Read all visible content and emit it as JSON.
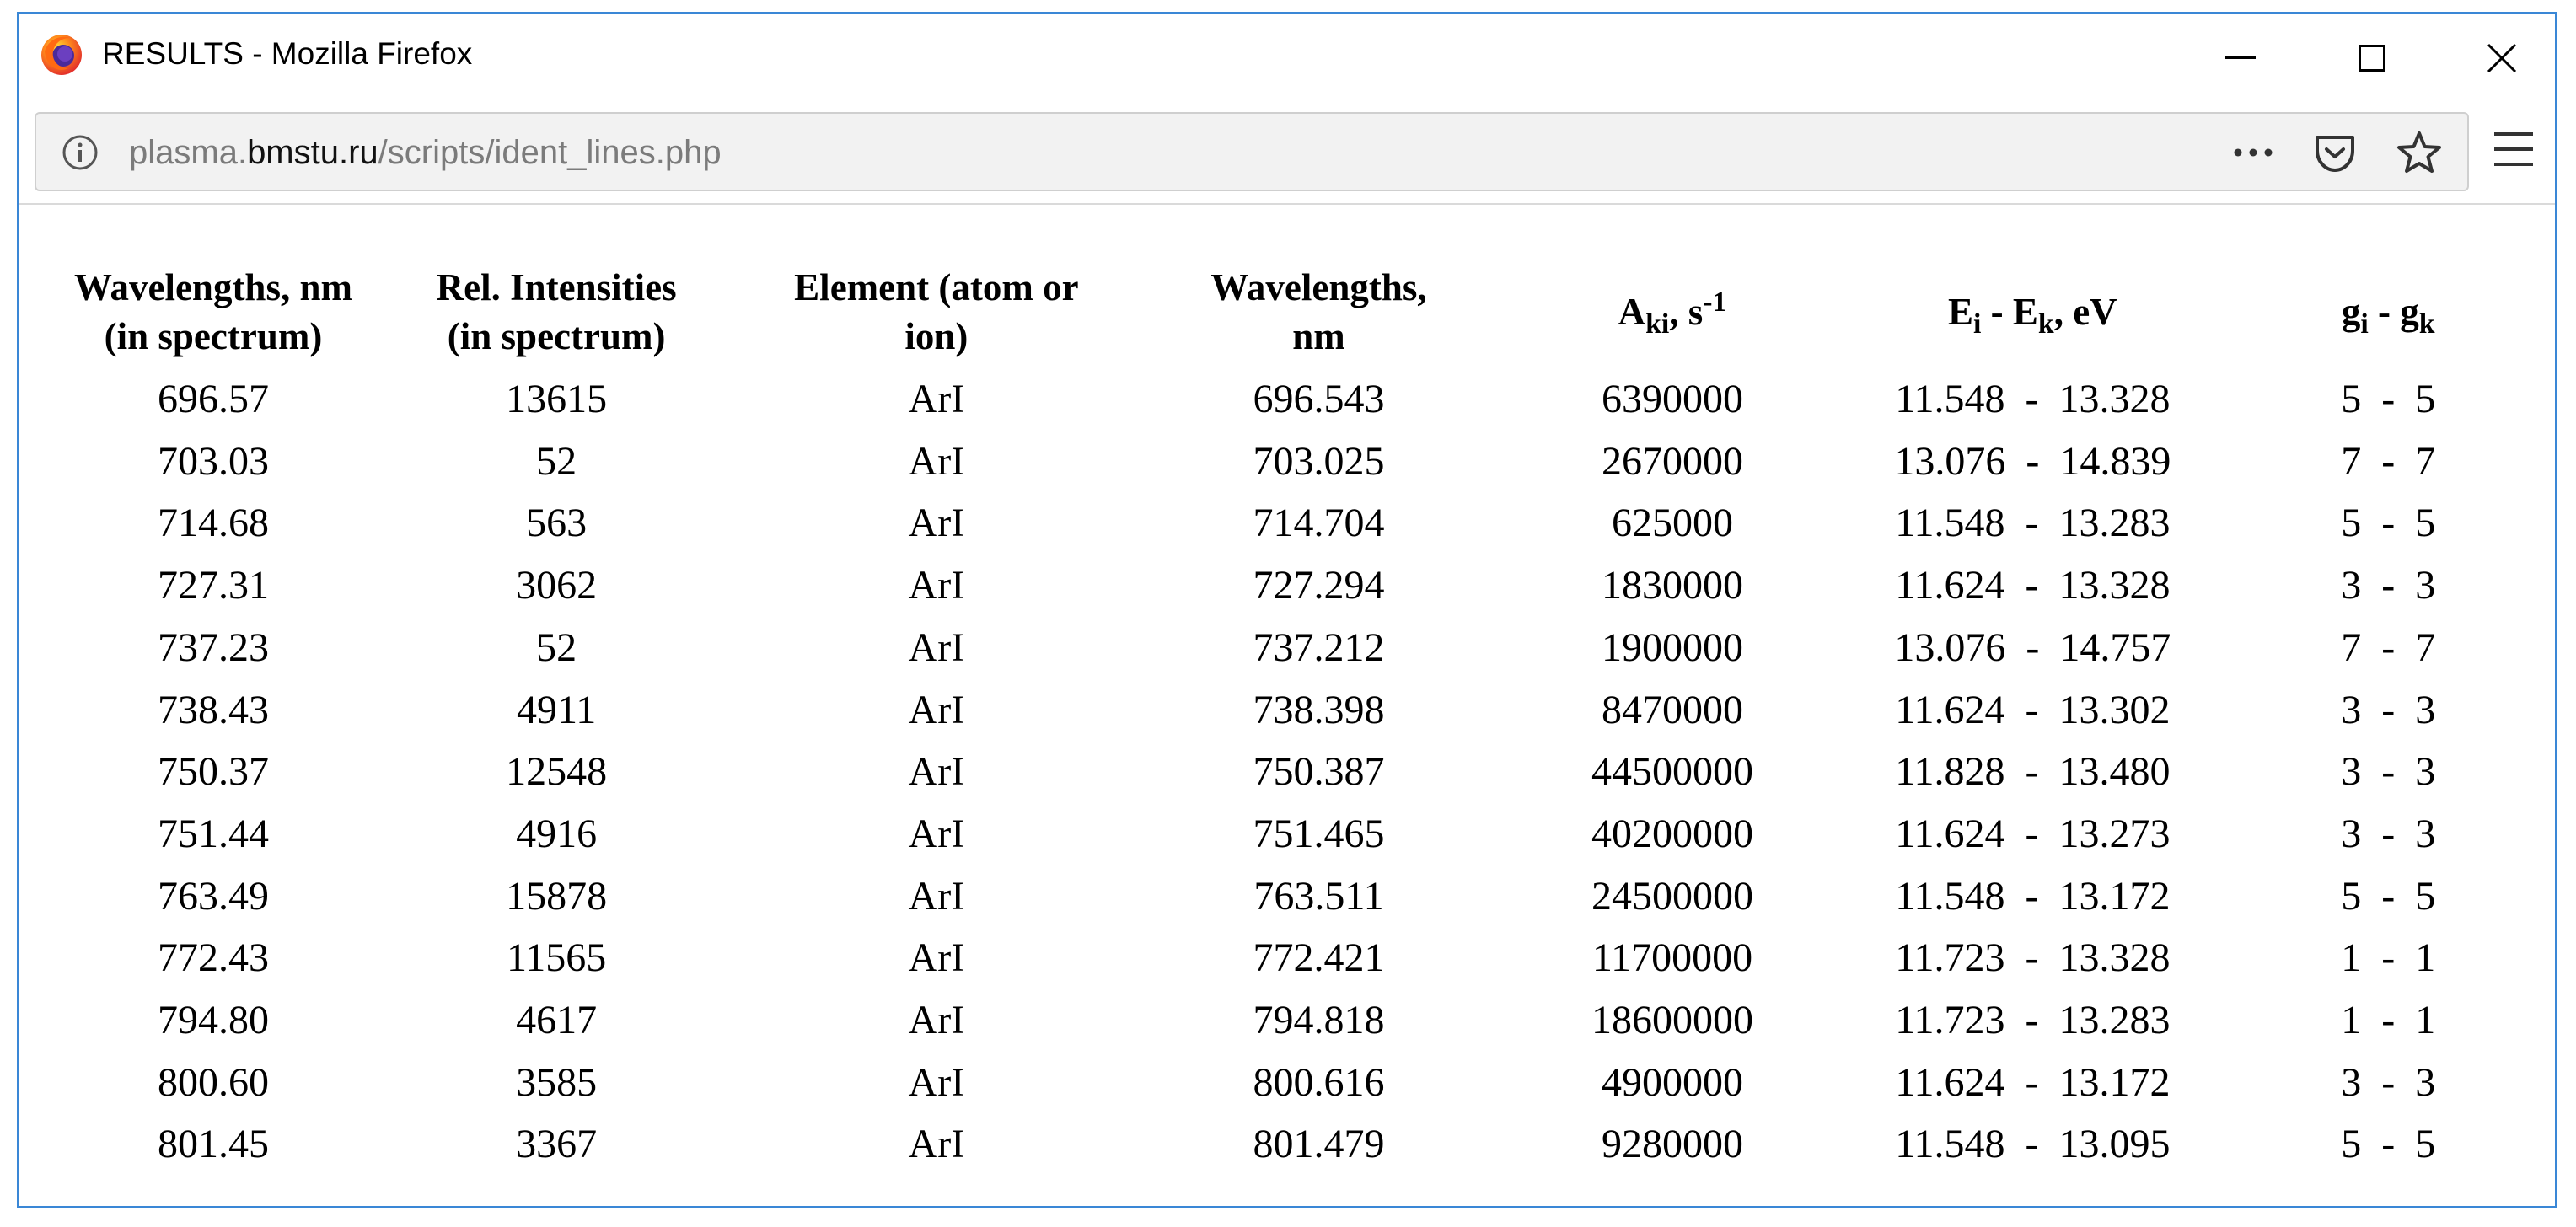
{
  "window": {
    "title": "RESULTS - Mozilla Firefox",
    "controls": {
      "minimize_icon": "minimize-icon",
      "maximize_icon": "maximize-icon",
      "close_icon": "close-icon"
    }
  },
  "urlbar": {
    "url_prefix": "plasma.",
    "url_domain": "bmstu.ru",
    "url_path": "/scripts/ident_lines.php",
    "icons": [
      "info-icon",
      "page-actions-icon",
      "pocket-icon",
      "bookmark-star-icon",
      "hamburger-menu-icon"
    ]
  },
  "colors": {
    "window_border": "#3a87d6",
    "urlbar_bg": "#f2f2f2",
    "url_gray": "#7b7b7b"
  },
  "table": {
    "headers": {
      "wl_spectrum_line1": "Wavelengths, nm",
      "wl_spectrum_line2": "(in spectrum)",
      "rel_int_line1": "Rel. Intensities",
      "rel_int_line2": "(in spectrum)",
      "element_line1": "Element (atom or",
      "element_line2": "ion)",
      "wl_line1": "Wavelengths,",
      "wl_line2": "nm",
      "aki_main": "A",
      "aki_sub": "ki",
      "aki_comma": ", s",
      "aki_sup": "-1",
      "energy_e1": "E",
      "energy_sub1": "i",
      "energy_mid": " - E",
      "energy_sub2": "k",
      "energy_unit": ", eV",
      "g_g1": "g",
      "g_sub1": "i",
      "g_mid": " - g",
      "g_sub2": "k"
    },
    "rows": [
      {
        "wl_spectrum": "696.57",
        "rel_intensity": "13615",
        "element": "ArI",
        "wavelength": "696.543",
        "aki": "6390000",
        "energy": "11.548  -  13.328",
        "g": "5  -  5"
      },
      {
        "wl_spectrum": "703.03",
        "rel_intensity": "52",
        "element": "ArI",
        "wavelength": "703.025",
        "aki": "2670000",
        "energy": "13.076  -  14.839",
        "g": "7  -  7"
      },
      {
        "wl_spectrum": "714.68",
        "rel_intensity": "563",
        "element": "ArI",
        "wavelength": "714.704",
        "aki": "625000",
        "energy": "11.548  -  13.283",
        "g": "5  -  5"
      },
      {
        "wl_spectrum": "727.31",
        "rel_intensity": "3062",
        "element": "ArI",
        "wavelength": "727.294",
        "aki": "1830000",
        "energy": "11.624  -  13.328",
        "g": "3  -  3"
      },
      {
        "wl_spectrum": "737.23",
        "rel_intensity": "52",
        "element": "ArI",
        "wavelength": "737.212",
        "aki": "1900000",
        "energy": "13.076  -  14.757",
        "g": "7  -  7"
      },
      {
        "wl_spectrum": "738.43",
        "rel_intensity": "4911",
        "element": "ArI",
        "wavelength": "738.398",
        "aki": "8470000",
        "energy": "11.624  -  13.302",
        "g": "3  -  3"
      },
      {
        "wl_spectrum": "750.37",
        "rel_intensity": "12548",
        "element": "ArI",
        "wavelength": "750.387",
        "aki": "44500000",
        "energy": "11.828  -  13.480",
        "g": "3  -  3"
      },
      {
        "wl_spectrum": "751.44",
        "rel_intensity": "4916",
        "element": "ArI",
        "wavelength": "751.465",
        "aki": "40200000",
        "energy": "11.624  -  13.273",
        "g": "3  -  3"
      },
      {
        "wl_spectrum": "763.49",
        "rel_intensity": "15878",
        "element": "ArI",
        "wavelength": "763.511",
        "aki": "24500000",
        "energy": "11.548  -  13.172",
        "g": "5  -  5"
      },
      {
        "wl_spectrum": "772.43",
        "rel_intensity": "11565",
        "element": "ArI",
        "wavelength": "772.421",
        "aki": "11700000",
        "energy": "11.723  -  13.328",
        "g": "1  -  1"
      },
      {
        "wl_spectrum": "794.80",
        "rel_intensity": "4617",
        "element": "ArI",
        "wavelength": "794.818",
        "aki": "18600000",
        "energy": "11.723  -  13.283",
        "g": "1  -  1"
      },
      {
        "wl_spectrum": "800.60",
        "rel_intensity": "3585",
        "element": "ArI",
        "wavelength": "800.616",
        "aki": "4900000",
        "energy": "11.624  -  13.172",
        "g": "3  -  3"
      },
      {
        "wl_spectrum": "801.45",
        "rel_intensity": "3367",
        "element": "ArI",
        "wavelength": "801.479",
        "aki": "9280000",
        "energy": "11.548  -  13.095",
        "g": "5  -  5"
      }
    ]
  }
}
